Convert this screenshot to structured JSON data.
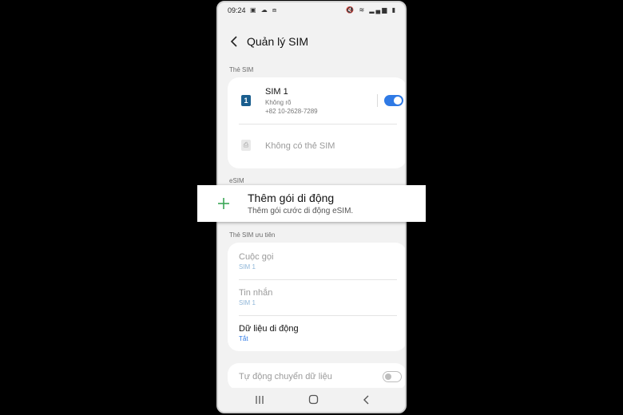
{
  "status_bar": {
    "time": "09:24",
    "left_icons": "▣ ☁ ⧈",
    "right_icons": "🔇 ≋ ▂▄▆ ▮"
  },
  "header": {
    "title": "Quản lý SIM"
  },
  "sim_cards": {
    "section_label": "Thẻ SIM",
    "sim1": {
      "badge": "1",
      "name": "SIM 1",
      "carrier": "Không rõ",
      "number": "+82 10-2628-7289",
      "enabled": true
    },
    "empty": {
      "label": "Không có thẻ SIM"
    }
  },
  "esim": {
    "section_label": "eSIM",
    "add_plan": {
      "title": "Thêm gói di động",
      "subtitle": "Thêm gói cước di động eSIM."
    }
  },
  "preferred": {
    "section_label": "Thẻ SIM ưu tiên",
    "calls": {
      "title": "Cuộc gọi",
      "value": "SIM 1"
    },
    "messages": {
      "title": "Tin nhắn",
      "value": "SIM 1"
    },
    "mobile_data": {
      "title": "Dữ liệu di động",
      "value": "Tắt"
    }
  },
  "auto_switch": {
    "label": "Tự động chuyển dữ liệu",
    "enabled": false
  },
  "colors": {
    "accent": "#2f7ae5",
    "sim_badge": "#1a5e8e",
    "plus": "#3aa757",
    "disabled_text": "#9a9a9a",
    "sub_link": "#5aa0d8"
  }
}
